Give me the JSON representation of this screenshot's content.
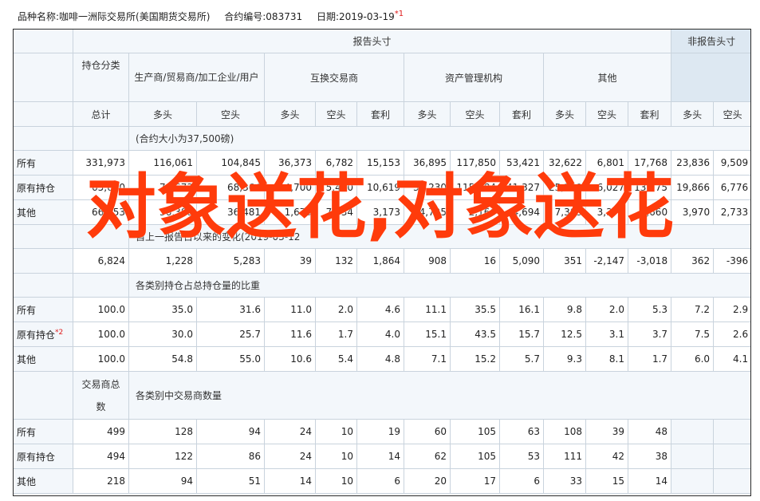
{
  "header": {
    "product_label": "品种名称:咖啡一洲际交易所(美国期货交易所)",
    "code_label": "合约编号:083731",
    "date_label": "日期:2019-03-19",
    "date_note": "*1"
  },
  "table": {
    "reported": "报告头寸",
    "nonreported": "非报告头寸",
    "position_category": "持仓分类",
    "groups": [
      "生产商/贸易商/加工企业/用户",
      "互换交易商",
      "资产管理机构",
      "其他"
    ],
    "total": "总计",
    "long": "多头",
    "short": "空头",
    "spread": "套利",
    "contract_size": "(合约大小为37,500磅)",
    "rows_positions": [
      {
        "label": "所有",
        "values": [
          "331,973",
          "116,061",
          "104,845",
          "36,373",
          "6,782",
          "15,153",
          "36,895",
          "117,850",
          "53,421",
          "32,622",
          "6,801",
          "17,768",
          "23,836",
          "9,509"
        ]
      },
      {
        "label": "原有持仓",
        "values": [
          "65,620",
          "79,673",
          "68,364",
          "34,700",
          "5,460",
          "10,619",
          "34,230",
          "115,684",
          "41,327",
          "25,239",
          "6,027",
          "13,775",
          "19,866",
          "6,776"
        ]
      },
      {
        "label": "其他",
        "values": [
          "66,353",
          "36,388",
          "36,481",
          "1,673",
          "7,034",
          "3,173",
          "4,735",
          "2,166",
          "4,694",
          "7,383",
          "3,374",
          "2,660",
          "3,970",
          "2,733"
        ]
      }
    ],
    "change_section": "自上一报告日以来的变化(2019-03-12",
    "change_values": [
      "6,824",
      "1,228",
      "5,283",
      "39",
      "132",
      "1,864",
      "908",
      "16",
      "5,090",
      "351",
      "-2,147",
      "-3,018",
      "362",
      "-396"
    ],
    "pct_section": "各类别持仓占总持仓量的比重",
    "rows_pct": [
      {
        "label": "所有",
        "note": "",
        "values": [
          "100.0",
          "35.0",
          "31.6",
          "11.0",
          "2.0",
          "4.6",
          "11.1",
          "35.5",
          "16.1",
          "9.8",
          "2.0",
          "5.3",
          "7.2",
          "2.9"
        ]
      },
      {
        "label": "原有持仓",
        "note": "*2",
        "values": [
          "100.0",
          "30.0",
          "25.7",
          "11.6",
          "1.7",
          "4.0",
          "15.1",
          "43.5",
          "15.7",
          "12.5",
          "3.1",
          "3.7",
          "7.5",
          "2.6"
        ]
      },
      {
        "label": "其他",
        "note": "",
        "values": [
          "100.0",
          "54.8",
          "55.0",
          "10.6",
          "5.4",
          "4.8",
          "7.1",
          "15.2",
          "5.7",
          "9.3",
          "8.1",
          "1.7",
          "6.0",
          "4.1"
        ]
      }
    ],
    "trader_total_line1": "交易商总",
    "trader_total_line2": "数",
    "trader_section": "各类别中交易商数量",
    "rows_traders": [
      {
        "label": "所有",
        "values": [
          "499",
          "128",
          "94",
          "24",
          "10",
          "19",
          "60",
          "105",
          "63",
          "108",
          "39",
          "48",
          "",
          ""
        ]
      },
      {
        "label": "原有持仓",
        "values": [
          "494",
          "122",
          "86",
          "24",
          "10",
          "14",
          "62",
          "105",
          "53",
          "111",
          "42",
          "38",
          "",
          ""
        ]
      },
      {
        "label": "其他",
        "values": [
          "218",
          "94",
          "51",
          "14",
          "10",
          "6",
          "20",
          "17",
          "6",
          "33",
          "15",
          "14",
          "",
          ""
        ]
      }
    ]
  },
  "overlay_text": "对象送花,对象送花"
}
